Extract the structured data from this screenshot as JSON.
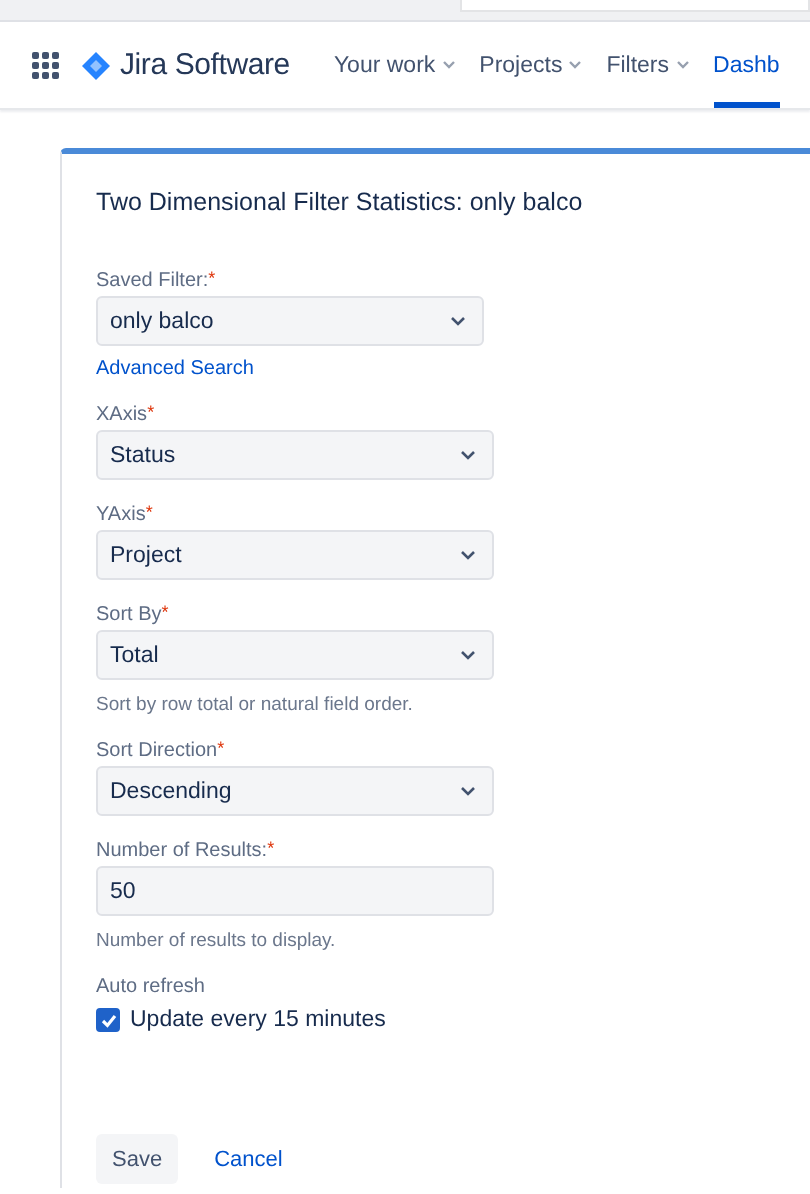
{
  "app": {
    "name": "Jira Software"
  },
  "nav": [
    {
      "label": "Your work",
      "dropdown": true,
      "selected": false
    },
    {
      "label": "Projects",
      "dropdown": true,
      "selected": false
    },
    {
      "label": "Filters",
      "dropdown": true,
      "selected": false
    },
    {
      "label": "Dashb",
      "dropdown": false,
      "selected": true
    }
  ],
  "form": {
    "title": "Two Dimensional Filter Statistics: only balco",
    "fields": [
      {
        "kind": "select",
        "label": "Saved Filter:$^{*}$",
        "value": "only balco",
        "link": "Advanced Search"
      },
      {
        "kind": "select",
        "label": "XAxis$^{*}$",
        "value": "Status"
      },
      {
        "kind": "select",
        "label": "YAxis$^{*}$",
        "value": "Project"
      },
      {
        "kind": "select",
        "label": "Sort By$^{*}$",
        "value": "Total",
        "help": "Sort by row total or natural field order."
      },
      {
        "kind": "select",
        "label": "Sort Direction$^{*}$",
        "value": "Descending"
      },
      {
        "kind": "text",
        "label": "Number of Results:$^{*}$",
        "value": "50",
        "help": "Number of results to display."
      }
    ],
    "auto_refresh": {
      "label": "Auto refresh",
      "option": "Update every 15 minutes",
      "checked": true
    },
    "buttons": [
      {
        "kind": "primary",
        "label": "Save"
      },
      {
        "kind": "link",
        "label": "Cancel"
      }
    ]
  }
}
